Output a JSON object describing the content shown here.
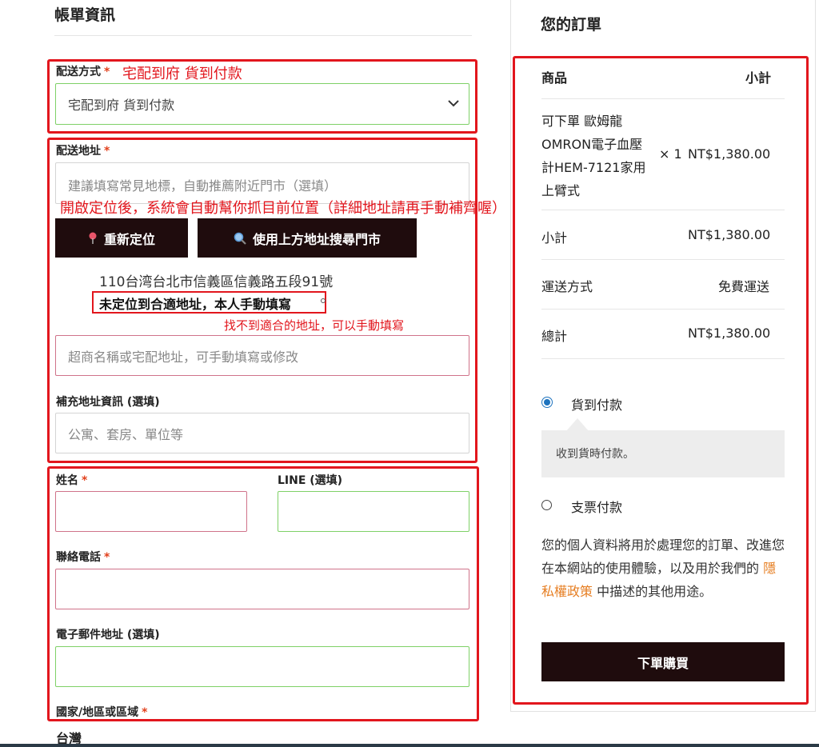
{
  "billing": {
    "title": "帳單資訊"
  },
  "shipping_method": {
    "label": "配送方式",
    "required": "*",
    "annotation": "宅配到府 貨到付款",
    "selected": "宅配到府 貨到付款"
  },
  "shipping_address": {
    "label": "配送地址",
    "required": "*",
    "landmark_placeholder": "建議填寫常見地標，自動推薦附近門市（選填）",
    "locate_note": "開啟定位後，系統會自動幫你抓目前位置（詳細地址請再手動補齊喔）",
    "relocate_button": "重新定位",
    "search_store_button": "使用上方地址搜尋門市",
    "detected_address": "110台湾台北市信義區信義路五段91號",
    "manual_option": "未定位到合適地址，本人手動填寫",
    "manual_note": "找不到適合的地址，可以手動填寫",
    "address_placeholder": "超商名稱或宅配地址，可手動填寫或修改"
  },
  "extra_address": {
    "label": "補充地址資訊 (選填)",
    "placeholder": "公寓、套房、單位等"
  },
  "name_field": {
    "label": "姓名",
    "required": "*"
  },
  "line_field": {
    "label": "LINE (選填)"
  },
  "phone_field": {
    "label": "聯絡電話",
    "required": "*"
  },
  "email_field": {
    "label": "電子郵件地址 (選填)"
  },
  "country_field": {
    "label": "國家/地區或區域",
    "required": "*",
    "value": "台灣"
  },
  "order": {
    "title": "您的訂單",
    "col_product": "商品",
    "col_subtotal": "小計",
    "item_name_lines": [
      "可下單 歐姆龍",
      "OMRON電子血壓",
      "計HEM-7121家用",
      "上臂式"
    ],
    "item_qty": "× 1",
    "item_price": "NT$1,380.00",
    "subtotal_label": "小計",
    "subtotal_value": "NT$1,380.00",
    "shipping_label": "運送方式",
    "shipping_value": "免費運送",
    "total_label": "總計",
    "total_value": "NT$1,380.00",
    "payment_cod": "貨到付款",
    "payment_cod_desc": "收到貨時付款。",
    "payment_cheque": "支票付款",
    "privacy_before": "您的個人資料將用於處理您的訂單、改進您在本網站的使用體驗，以及用於我們的",
    "privacy_link": "隱私權政策",
    "privacy_after": "中描述的其他用途。",
    "place_order": "下單購買"
  },
  "colors": {
    "annotation_red": "#e2161d",
    "dark_button": "#1f0c0d",
    "radio_blue": "#1e73be",
    "privacy_link": "#e67e22"
  }
}
